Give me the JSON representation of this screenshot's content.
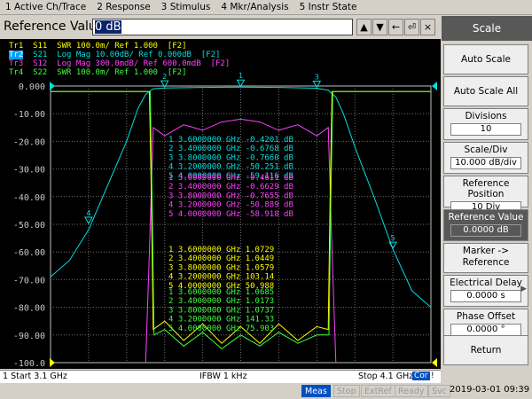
{
  "menu": [
    "1 Active Ch/Trace",
    "2 Response",
    "3 Stimulus",
    "4 Mkr/Analysis",
    "5 Instr State"
  ],
  "entry": {
    "label": "Reference Value",
    "value": "0 dB",
    "buttons": [
      "▲",
      "▼",
      "←",
      "⏎",
      "×"
    ]
  },
  "traces": [
    {
      "text": "Tr1  S11  SWR 100.0m/ Ref 1.000  [F2]",
      "color": "#ffff00"
    },
    {
      "text": "Tr2  S21  Log Mag 10.00dB/ Ref 0.000dB  [F2]",
      "color": "#00e0e0",
      "active": "Tr2"
    },
    {
      "text": "Tr3  S12  Log Mag 300.0mdB/ Ref 600.0mdB  [F2]",
      "color": "#ff40ff"
    },
    {
      "text": "Tr4  S22  SWR 100.0m/ Ref 1.000  [F2]",
      "color": "#40ff40"
    }
  ],
  "yticks": [
    "0.000",
    "-10.00",
    "-20.00",
    "-30.00",
    "-40.00",
    "-50.00",
    "-60.00",
    "-70.00",
    "-80.00",
    "-90.00",
    "-100.0"
  ],
  "marker_tables": [
    {
      "color": "#00e0e0",
      "rows": [
        [
          "1",
          "3.6000000 GHz",
          "-0.4201 dB"
        ],
        [
          "2",
          "3.4000000 GHz",
          "-0.6768 dB"
        ],
        [
          "3",
          "3.8000000 GHz",
          "-0.7660 dB"
        ],
        [
          "4",
          "3.2000000 GHz",
          "-50.251 dB"
        ],
        [
          "5",
          "4.0000000 GHz",
          "-59.116 dB"
        ]
      ]
    },
    {
      "color": "#ff40ff",
      "rows": [
        [
          "1",
          "3.6000000 GHz",
          "-0.4611 dB"
        ],
        [
          "2",
          "3.4000000 GHz",
          "-0.6629 dB"
        ],
        [
          "3",
          "3.8000000 GHz",
          "-0.7655 dB"
        ],
        [
          "4",
          "3.2000000 GHz",
          "-50.889 dB"
        ],
        [
          "5",
          "4.0000000 GHz",
          "-58.918 dB"
        ]
      ]
    },
    {
      "color": "#ffff00",
      "rows": [
        [
          "1",
          "3.6000000 GHz",
          "1.0729"
        ],
        [
          "2",
          "3.4000000 GHz",
          "1.0449"
        ],
        [
          "3",
          "3.8000000 GHz",
          "1.0579"
        ],
        [
          "4",
          "3.2000000 GHz",
          "103.14"
        ],
        [
          "5",
          "4.0000000 GHz",
          "50.988"
        ]
      ]
    },
    {
      "color": "#40ff40",
      "rows": [
        [
          "1",
          "3.6000000 GHz",
          "1.0685"
        ],
        [
          "2",
          "3.4000000 GHz",
          "1.0173"
        ],
        [
          "3",
          "3.8000000 GHz",
          "1.0737"
        ],
        [
          "4",
          "3.2000000 GHz",
          "141.33"
        ],
        [
          "5",
          "4.0000000 GHz",
          "75.903"
        ]
      ]
    }
  ],
  "status": {
    "start": "1  Start 3.1 GHz",
    "ifbw": "IFBW 1 kHz",
    "stop": "Stop 4.1 GHz"
  },
  "bottom": {
    "meas": "Meas",
    "stop": "Stop",
    "extref": "ExtRef",
    "ready": "Ready",
    "svc": "Svc",
    "datetime": "2019-03-01 09:39"
  },
  "softkeys": {
    "title": "Scale",
    "auto_scale": "Auto Scale",
    "auto_scale_all": "Auto Scale All",
    "divisions_label": "Divisions",
    "divisions_value": "10",
    "scale_div_label": "Scale/Div",
    "scale_div_value": "10.000 dB/div",
    "ref_pos_label": "Reference Position",
    "ref_pos_value": "10 Div",
    "ref_val_label": "Reference Value",
    "ref_val_value": "0.0000 dB",
    "marker_ref_label": "Marker ->",
    "marker_ref_label2": "Reference",
    "elec_delay_label": "Electrical Delay",
    "elec_delay_value": "0.0000 s",
    "phase_offset_label": "Phase Offset",
    "phase_offset_value": "0.0000 °",
    "return": "Return"
  },
  "chart_data": {
    "type": "line",
    "xlabel": "",
    "ylabel": "",
    "xlim": [
      3.1,
      4.1
    ],
    "ylim": [
      -100,
      0
    ],
    "grid": true
  }
}
